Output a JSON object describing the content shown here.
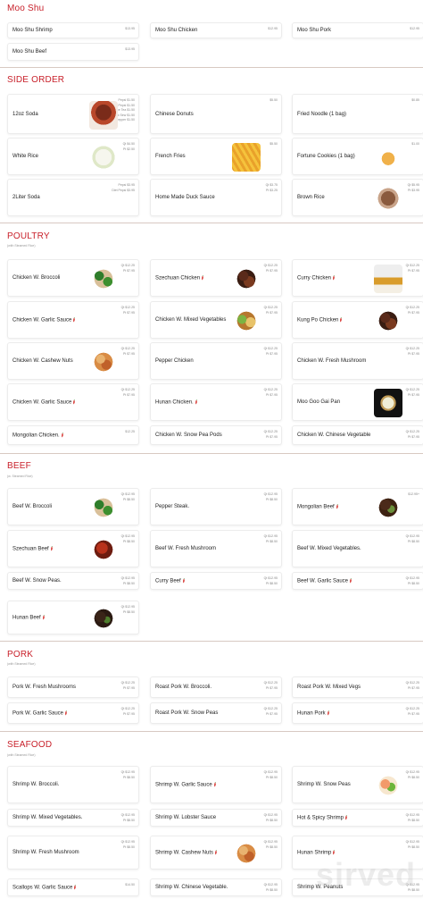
{
  "sections": [
    {
      "title": "Moo Shu",
      "subtitle": "",
      "items": [
        {
          "name": "Moo Shu Shrimp",
          "price": "$13.95"
        },
        {
          "name": "Moo Shu Chicken",
          "price": "$12.95"
        },
        {
          "name": "Moo Shu Pork",
          "price": "$12.95"
        },
        {
          "name": "Moo Shu Beef",
          "price": "$13.95"
        }
      ]
    },
    {
      "title": "SIDE ORDER",
      "subtitle": "",
      "items": [
        {
          "name": "12oz Soda",
          "price": "Pepsi $1.50\nDiet Pepsi $1.50\nIce Tea $1.50\nMist Sew $1.50\nDr Pepper $1.50",
          "img": "soda"
        },
        {
          "name": "Chinese Donuts",
          "price": "$5.50"
        },
        {
          "name": "Fried Noodle (1 bag)",
          "price": "$0.85"
        },
        {
          "name": "White Rice",
          "price": "Qt $4.50\nPt $2.50",
          "img": "rice"
        },
        {
          "name": "French Fries",
          "price": "$5.50",
          "img": "fries"
        },
        {
          "name": "Fortune Cookies (1 bag)",
          "price": "$1.00",
          "img": "cookie"
        },
        {
          "name": "2Liter Soda",
          "price": "Pepsi $3.95\nDiet Pepsi $3.95"
        },
        {
          "name": "Home Made Duck Sauce",
          "price": "Qt $3.75\nPt $3.25"
        },
        {
          "name": "Brown Rice",
          "price": "Qt $5.95\nPt $3.95",
          "img": "brownrice"
        }
      ]
    },
    {
      "title": "POULTRY",
      "subtitle": "(with Steamed Rice)",
      "items": [
        {
          "name": "Chicken W. Broccoli",
          "price": "Qt $12.25\nPt $7.95",
          "img": "broccoli"
        },
        {
          "name": "Szechuan Chicken",
          "price": "Qt $12.25\nPt $7.95",
          "img": "dark",
          "hot": true
        },
        {
          "name": "Curry Chicken",
          "price": "Qt $12.25\nPt $7.95",
          "img": "curry",
          "hot": true
        },
        {
          "name": "Chicken W. Garlic Sauce",
          "price": "Qt $12.25\nPt $7.95",
          "hot": true
        },
        {
          "name": "Chicken W. Mixed Vegetables",
          "price": "Qt $12.25\nPt $7.95",
          "img": "mixed"
        },
        {
          "name": "Kung Po Chicken",
          "price": "Qt $12.25\nPt $7.95",
          "img": "dark",
          "hot": true
        },
        {
          "name": "Chicken W. Cashew Nuts",
          "price": "Qt $12.25\nPt $7.95",
          "img": "cashew"
        },
        {
          "name": "Pepper Chicken",
          "price": "Qt $12.25\nPt $7.95"
        },
        {
          "name": "Chicken W. Fresh Mushroom",
          "price": "Qt $12.25\nPt $7.95"
        },
        {
          "name": "Chicken W. Garlic Sauce",
          "price": "Qt $12.25\nPt $7.95",
          "hot": true
        },
        {
          "name": "Hunan Chicken.",
          "price": "Qt $12.25\nPt $7.95",
          "hot": true
        },
        {
          "name": "Moo Goo Gai Pan",
          "price": "Qt $12.25\nPt $7.95",
          "img": "moogoo"
        },
        {
          "name": "Mongolian Chicken.",
          "price": "$12.25",
          "hot": true
        },
        {
          "name": "Chicken W. Snow Pea Pods",
          "price": "Qt $12.25\nPt $7.95"
        },
        {
          "name": "Chicken W. Chinese Vegetable",
          "price": "Qt $12.25\nPt $7.95"
        }
      ]
    },
    {
      "title": "BEEF",
      "subtitle": "(w. Steamed Rice)",
      "items": [
        {
          "name": "Beef W. Broccoli",
          "price": "Qt $12.95\nPt $8.50",
          "img": "broccoli"
        },
        {
          "name": "Pepper Steak.",
          "price": "Qt $12.95\nPt $8.50"
        },
        {
          "name": "Mongolian Beef",
          "price": "$12.95+",
          "img": "mongolian",
          "hot": true
        },
        {
          "name": "Szechuan Beef",
          "price": "Qt $12.95\nPt $8.50",
          "img": "red",
          "hot": true
        },
        {
          "name": "Beef W. Fresh Mushroom",
          "price": "Qt $12.95\nPt $8.50"
        },
        {
          "name": "Beef W. Mixed Vegetables.",
          "price": "Qt $12.95\nPt $8.50"
        },
        {
          "name": "Beef W. Snow Peas.",
          "price": "Qt $12.95\nPt $8.50"
        },
        {
          "name": "Curry Beef",
          "price": "Qt $12.95\nPt $8.50",
          "hot": true
        },
        {
          "name": "Beef W. Garlic Sauce",
          "price": "Qt $12.95\nPt $8.50",
          "hot": true
        },
        {
          "name": "Hunan Beef",
          "price": "Qt $12.95\nPt $8.50",
          "img": "hunan",
          "hot": true
        }
      ]
    },
    {
      "title": "PORK",
      "subtitle": "(with Steamed Rice)",
      "items": [
        {
          "name": "Pork W. Fresh Mushrooms",
          "price": "Qt $12.25\nPt $7.95"
        },
        {
          "name": "Roast Pork W. Broccoli.",
          "price": "Qt $12.25\nPt $7.95"
        },
        {
          "name": "Roast Pork W. Mixed Vegs",
          "price": "Qt $12.25\nPt $7.95"
        },
        {
          "name": "Pork W. Garlic Sauce",
          "price": "Qt $12.25\nPt $7.95",
          "hot": true
        },
        {
          "name": "Roast Pork W. Snow Peas",
          "price": "Qt $12.25\nPt $7.95"
        },
        {
          "name": "Hunan Pork",
          "price": "Qt $12.25\nPt $7.95",
          "hot": true
        }
      ]
    },
    {
      "title": "SEAFOOD",
      "subtitle": "(with Steamed Rice)",
      "items": [
        {
          "name": "Shrimp W. Broccoli.",
          "price": "Qt $12.95\nPt $8.50"
        },
        {
          "name": "Shrimp W. Garlic Sauce",
          "price": "Qt $12.95\nPt $8.50",
          "hot": true
        },
        {
          "name": "Shrimp W. Snow Peas",
          "price": "Qt $12.95\nPt $8.50",
          "img": "shrimp"
        },
        {
          "name": "Shrimp W. Mixed Vegetables.",
          "price": "Qt $12.95\nPt $8.50"
        },
        {
          "name": "Shrimp W. Lobster Sauce",
          "price": "Qt $12.95\nPt $8.50"
        },
        {
          "name": "Hot & Spicy Shrimp",
          "price": "Qt $12.95\nPt $8.50",
          "hot": true
        },
        {
          "name": "Shrimp W. Fresh Mushroom",
          "price": "Qt $12.95\nPt $8.50"
        },
        {
          "name": "Shrimp W. Cashew Nuts",
          "price": "Qt $12.95\nPt $8.50",
          "img": "cashew",
          "hot": true
        },
        {
          "name": "Hunan Shrimp",
          "price": "Qt $12.95\nPt $8.50",
          "hot": true
        },
        {
          "name": "Scallops W. Garlic Sauce",
          "price": "$14.50",
          "hot": true
        },
        {
          "name": "Shrimp W. Chinese Vegetable.",
          "price": "Qt $12.95\nPt $8.50"
        },
        {
          "name": "Shrimp W. Peanuts",
          "price": "Qt $12.95\nPt $8.50"
        }
      ]
    }
  ],
  "watermark": "sirved"
}
